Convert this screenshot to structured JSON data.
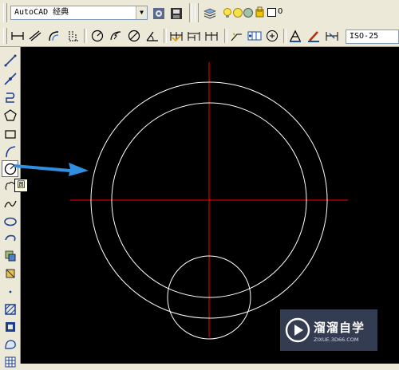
{
  "workspace": {
    "selected": "AutoCAD 经典"
  },
  "layer": {
    "name": "0"
  },
  "dimension_style": {
    "selected": "ISO-25"
  },
  "left_toolbar": {
    "tools": [
      {
        "name": "line-tool-icon"
      },
      {
        "name": "construction-line-tool-icon"
      },
      {
        "name": "polyline-tool-icon"
      },
      {
        "name": "polygon-tool-icon"
      },
      {
        "name": "rectangle-tool-icon"
      },
      {
        "name": "arc-tool-icon"
      },
      {
        "name": "circle-tool-icon",
        "active": true
      },
      {
        "name": "revision-cloud-tool-icon"
      },
      {
        "name": "spline-tool-icon"
      },
      {
        "name": "ellipse-tool-icon"
      },
      {
        "name": "ellipse-arc-tool-icon"
      },
      {
        "name": "insert-block-tool-icon"
      },
      {
        "name": "make-block-tool-icon"
      },
      {
        "name": "point-tool-icon"
      },
      {
        "name": "hatch-tool-icon"
      },
      {
        "name": "gradient-tool-icon"
      },
      {
        "name": "region-tool-icon"
      },
      {
        "name": "table-tool-icon"
      }
    ]
  },
  "tooltip": {
    "text": "圆"
  },
  "canvas": {
    "background": "#000000",
    "centerline_color": "#ff0000",
    "geometry_color": "#ffffff",
    "arrow_color": "#2f8fe0"
  },
  "watermark": {
    "title": "溜溜自学",
    "url": "ZIXUE.3D66.COM"
  }
}
